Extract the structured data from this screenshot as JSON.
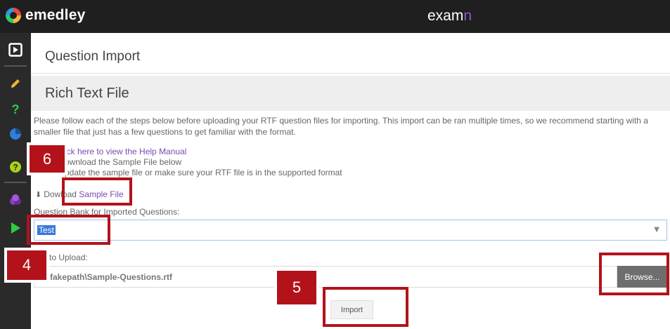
{
  "header": {
    "logo_text": "emedley",
    "brand_main": "exam",
    "brand_accent": "n"
  },
  "sidebar": {
    "icons": [
      "play-icon",
      "pencil-icon",
      "question-icon",
      "pie-chart-icon",
      "help-icon",
      "layers-icon",
      "play-arrow-icon"
    ]
  },
  "page": {
    "title": "Question Import",
    "section_title": "Rich Text File",
    "intro": "Please follow each of the steps below before uploading your RTF question files for importing. This import can be ran multiple times, so we recommend starting with a smaller file that just has a few questions to get familiar with the format.",
    "steps": {
      "step1_link": "ick here to view the Help Manual",
      "step2": "ownload the Sample File below",
      "step3": "pdate the sample file or make sure your RTF file is in the supported format"
    },
    "download": {
      "prefix": "Dow",
      "link_part1": "load ",
      "link_part2": "Sample File"
    },
    "bank_label": "Question Bank for Imported Questions:",
    "bank_selected": "Test",
    "file_label": "to Upload:",
    "file_value": "fakepath\\Sample-Questions.rtf",
    "browse_label": "Browse...",
    "import_label": "Import"
  },
  "annotations": {
    "badge_6": "6",
    "badge_4": "4",
    "badge_5": "5"
  },
  "colors": {
    "topbar": "#1f1f1f",
    "sidebar": "#2a2a2a",
    "link": "#7a4bb0",
    "annotation": "#b3121b",
    "selection": "#3a78d8"
  }
}
